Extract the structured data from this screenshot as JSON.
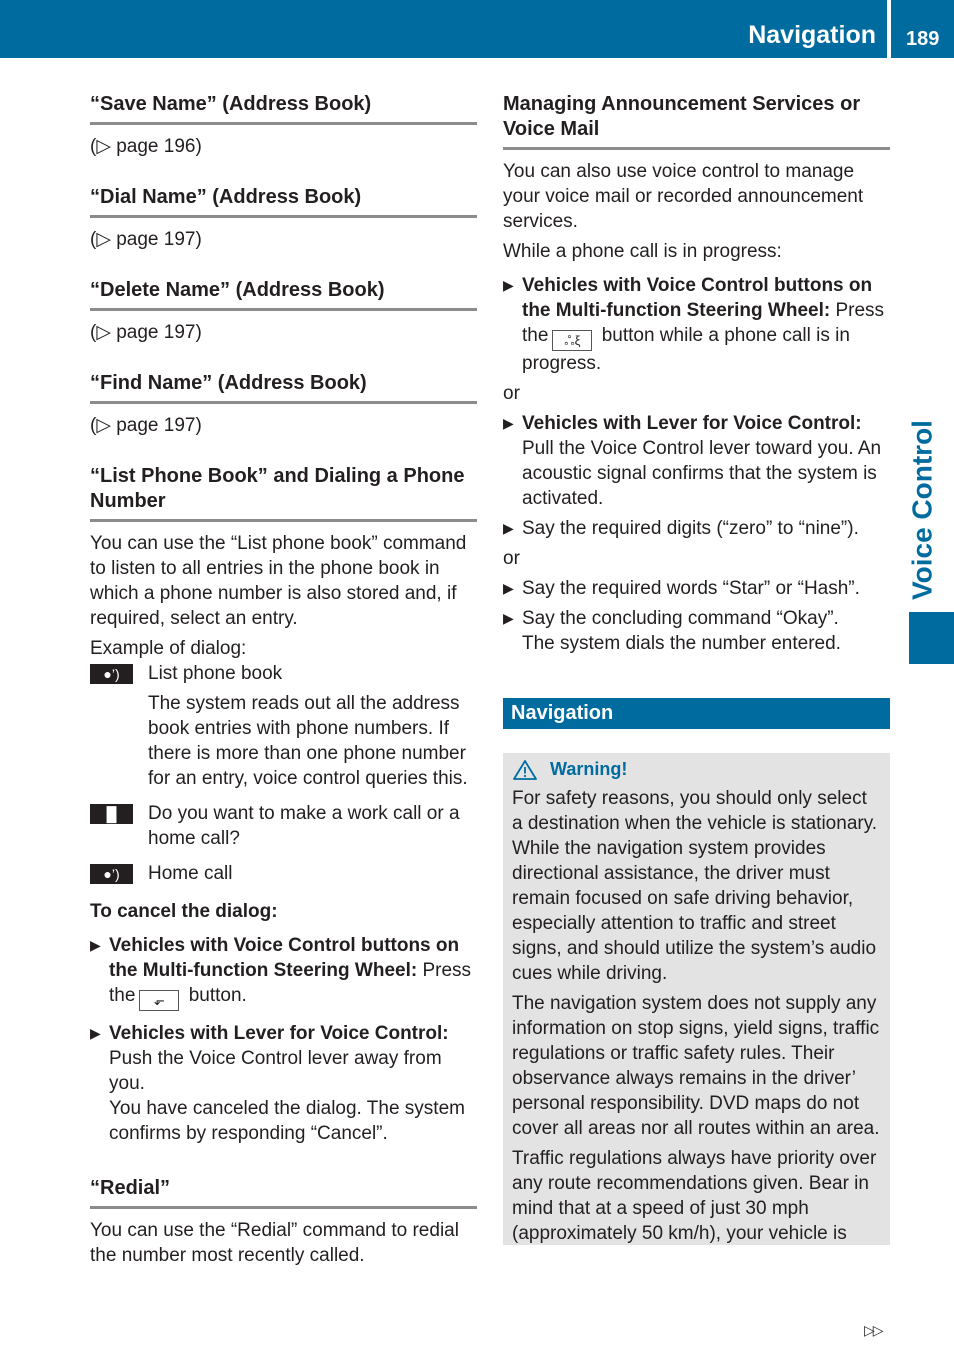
{
  "header": {
    "title": "Navigation",
    "page_number": "189"
  },
  "side_tab": {
    "label": "Voice Control"
  },
  "left": {
    "sections": [
      {
        "heading": "“Save Name” (Address Book)",
        "ref": "(▷ page 196)"
      },
      {
        "heading": "“Dial Name” (Address Book)",
        "ref": "(▷ page 197)"
      },
      {
        "heading": "“Delete Name” (Address Book)",
        "ref": "(▷ page 197)"
      },
      {
        "heading": "“Find Name” (Address Book)",
        "ref": "(▷ page 197)"
      }
    ],
    "list_phone_book": {
      "heading": "“List Phone Book” and Dialing a Phone Number",
      "intro": "You can use the “List phone book” command to listen to all entries in the phone book in which a phone number is also stored and, if required, select an entry.",
      "example_label": "Example of dialog:",
      "dialog": [
        {
          "icon": "user-speaking-icon",
          "glyph": "●’)",
          "lines": [
            "List phone book",
            "The system reads out all the address book entries with phone numbers. If there is more than one phone number for an entry, voice control queries this."
          ]
        },
        {
          "icon": "system-speaker-icon",
          "glyph": "▐▌",
          "lines": [
            "Do you want to make a work call or a home call?"
          ]
        },
        {
          "icon": "user-speaking-icon",
          "glyph": "●’)",
          "lines": [
            "Home call"
          ]
        }
      ],
      "cancel_label": "To cancel the dialog:",
      "steps": [
        {
          "bold": "Vehicles with Voice Control buttons on the Multi-function Steering Wheel:",
          "before_key": " Press the",
          "key_icon": "back-button-icon",
          "key_glyph": "⬐",
          "after_key": " button."
        },
        {
          "bold": "Vehicles with Lever for Voice Control:",
          "text": "Push the Voice Control lever away from you.",
          "result": "You have canceled the dialog. The system confirms by responding “Cancel”."
        }
      ]
    },
    "redial": {
      "heading": "“Redial”",
      "text": "You can use the “Redial” command to redial the number most recently called."
    }
  },
  "right": {
    "voice_mail": {
      "heading": "Managing Announcement Services or Voice Mail",
      "intro": "You can also use voice control to manage your voice mail or recorded announcement services.",
      "while_label": "While a phone call is in progress:",
      "step1": {
        "bold": "Vehicles with Voice Control buttons on the Multi-function Steering Wheel:",
        "before_key": " Press the",
        "key_icon": "voice-control-button-icon",
        "key_glyph": "ஃξ",
        "after_key": " button while a phone call is in progress."
      },
      "or1": "or",
      "step2": {
        "bold": "Vehicles with Lever for Voice Control:",
        "text": "Pull the Voice Control lever toward you. An acoustic signal confirms that the system is activated."
      },
      "step3": "Say the required digits (“zero” to “nine”).",
      "or2": "or",
      "step4": "Say the required words “Star” or “Hash”.",
      "step5": {
        "text": "Say the concluding command “Okay”.",
        "result": "The system dials the number entered."
      }
    },
    "navigation": {
      "bar_title": "Navigation",
      "warning_title": "Warning!",
      "paragraphs": [
        "For safety reasons, you should only select a destination when the vehicle is stationary. While the navigation system provides directional assistance, the driver must remain focused on safe driving behavior, especially attention to traffic and street signs, and should utilize the system’s audio cues while driving.",
        "The navigation system does not supply any information on stop signs, yield signs, traffic regulations or traffic safety rules. Their observance always remains in the driver’ personal responsibility. DVD maps do not cover all areas nor all routes within an area.",
        "Traffic regulations always have priority over any route recommendations given. Bear in mind that at a speed of just 30 mph (approximately 50 km/h), your vehicle is"
      ]
    }
  },
  "footer": {
    "continue_glyph": "▷▷"
  },
  "colors": {
    "brand_blue": "#006b9f",
    "warning_bg": "#e3e3e3",
    "rule_gray": "#8c8c8c"
  }
}
